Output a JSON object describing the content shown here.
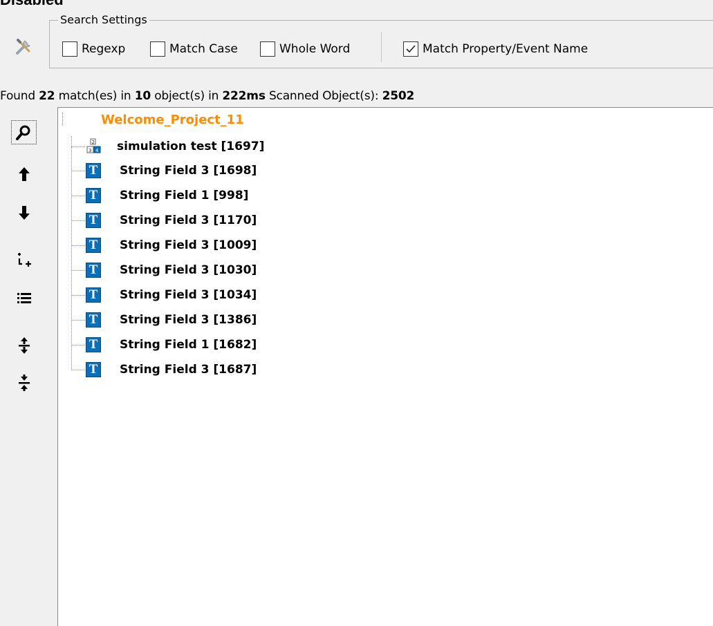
{
  "window": {
    "top_cut_text": "Disabled"
  },
  "search_settings": {
    "title": "Search Settings",
    "icon": "wrench-screwdriver-icon",
    "options": [
      {
        "label": "Regexp",
        "checked": false
      },
      {
        "label": "Match Case",
        "checked": false
      },
      {
        "label": "Whole Word",
        "checked": false
      },
      {
        "label": "Match Property/Event Name",
        "checked": true
      }
    ]
  },
  "status": {
    "found_prefix": "Found",
    "match_count": "22",
    "match_text": "match(es) in",
    "object_count": "10",
    "object_text": "object(s) in",
    "time": "222ms",
    "scanned_text": "Scanned Object(s):",
    "scanned_count": "2502"
  },
  "toolbar": {
    "buttons": [
      {
        "name": "find",
        "icon": "magnifier-icon"
      },
      {
        "name": "previous",
        "icon": "arrow-up-icon"
      },
      {
        "name": "next",
        "icon": "arrow-down-icon"
      },
      {
        "name": "expand-children",
        "icon": "expand-tree-icon"
      },
      {
        "name": "list",
        "icon": "list-icon"
      },
      {
        "name": "expand-all",
        "icon": "expand-all-icon"
      },
      {
        "name": "collapse-all",
        "icon": "collapse-all-icon"
      }
    ]
  },
  "tree": {
    "root": "Welcome_Project_11",
    "root_color": "#ff8c00",
    "items": [
      {
        "label": "simulation test [1697]",
        "icon": "grid-screen-icon"
      },
      {
        "label": "String Field 3 [1698]",
        "icon": "text-field-icon"
      },
      {
        "label": "String Field 1 [998]",
        "icon": "text-field-icon"
      },
      {
        "label": "String Field 3 [1170]",
        "icon": "text-field-icon"
      },
      {
        "label": "String Field 3 [1009]",
        "icon": "text-field-icon"
      },
      {
        "label": "String Field 3 [1030]",
        "icon": "text-field-icon"
      },
      {
        "label": "String Field 3 [1034]",
        "icon": "text-field-icon"
      },
      {
        "label": "String Field 3 [1386]",
        "icon": "text-field-icon"
      },
      {
        "label": "String Field 1 [1682]",
        "icon": "text-field-icon"
      },
      {
        "label": "String Field 3 [1687]",
        "icon": "text-field-icon"
      }
    ],
    "text_icon_glyph": "T"
  }
}
